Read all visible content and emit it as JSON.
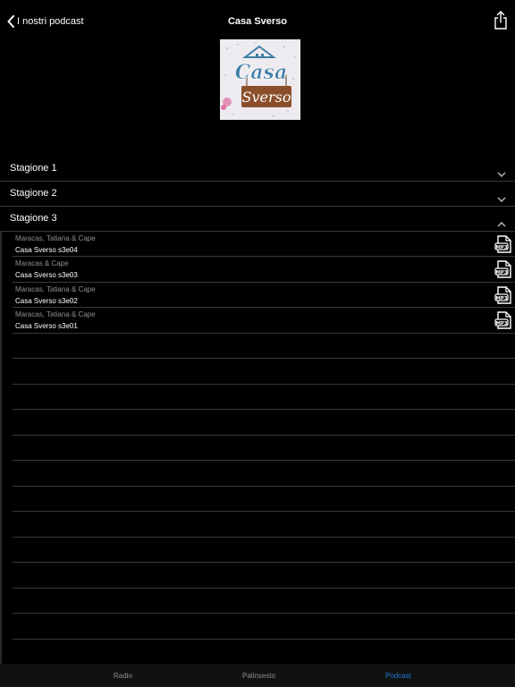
{
  "nav": {
    "back_label": "I nostri podcast",
    "title": "Casa Sverso",
    "back_icon": "chevron-left-icon",
    "share_icon": "share-icon"
  },
  "cover": {
    "line1": "Casa",
    "line2": "Sverso"
  },
  "seasons": [
    {
      "label": "Stagione 1",
      "expanded": false,
      "icon": "chevron-down-icon"
    },
    {
      "label": "Stagione 2",
      "expanded": false,
      "icon": "chevron-down-icon"
    },
    {
      "label": "Stagione 3",
      "expanded": true,
      "icon": "chevron-up-icon"
    }
  ],
  "episodes": [
    {
      "hosts": "Maracas, Tatiana & Cape",
      "title": "Casa Sverso s3e04",
      "icon": "mp3-file-icon"
    },
    {
      "hosts": "Maracas & Cape",
      "title": "Casa Sverso s3e03",
      "icon": "mp3-file-icon"
    },
    {
      "hosts": "Maracas, Tatiana & Cape",
      "title": "Casa Sverso s3e02",
      "icon": "mp3-file-icon"
    },
    {
      "hosts": "Maracas, Tatiana & Cape",
      "title": "Casa Sverso s3e01",
      "icon": "mp3-file-icon"
    }
  ],
  "tabs": [
    {
      "label": "Radio",
      "active": false
    },
    {
      "label": "Palinsesto",
      "active": false
    },
    {
      "label": "Podcast",
      "active": true
    }
  ],
  "colors": {
    "background": "#000000",
    "divider": "#3a3a3c",
    "secondary_text": "#8e8e93",
    "active_tab": "#1e7cd8",
    "cover_blue": "#3d7fa5",
    "cover_brown": "#8a4f2a"
  }
}
